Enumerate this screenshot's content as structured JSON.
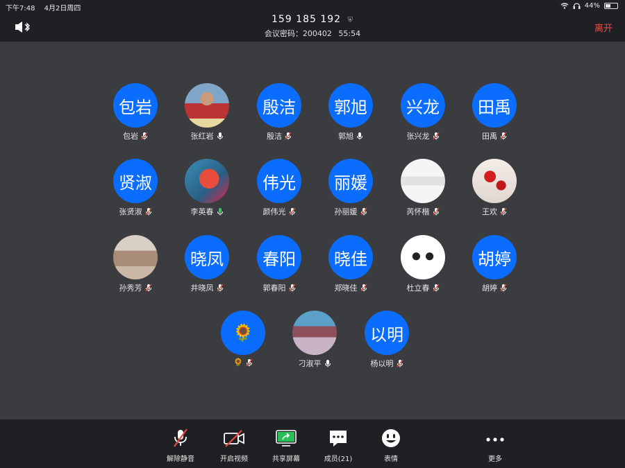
{
  "status": {
    "time": "下午7:48",
    "date": "4月2日周四",
    "battery": "44%",
    "battery_level": 0.44
  },
  "header": {
    "meeting_id": "159 185 192",
    "sub_label": "会议密码：200402",
    "elapsed": "55:54",
    "leave_label": "离开"
  },
  "participants": [
    {
      "avatar_text": "包岩",
      "name": "包岩",
      "mic": "muted"
    },
    {
      "avatar_text": "",
      "name": "张红岩",
      "mic": "on"
    },
    {
      "avatar_text": "殷洁",
      "name": "殷洁",
      "mic": "muted"
    },
    {
      "avatar_text": "郭旭",
      "name": "郭旭",
      "mic": "on"
    },
    {
      "avatar_text": "兴龙",
      "name": "张兴龙",
      "mic": "muted"
    },
    {
      "avatar_text": "田禹",
      "name": "田禹",
      "mic": "muted"
    },
    {
      "avatar_text": "贤淑",
      "name": "张贤淑",
      "mic": "muted"
    },
    {
      "avatar_text": "",
      "name": "李英春",
      "mic": "active"
    },
    {
      "avatar_text": "伟光",
      "name": "颜伟光",
      "mic": "muted"
    },
    {
      "avatar_text": "丽媛",
      "name": "孙丽媛",
      "mic": "muted"
    },
    {
      "avatar_text": "",
      "name": "芮怀楷",
      "mic": "muted"
    },
    {
      "avatar_text": "",
      "name": "王欢",
      "mic": "muted"
    },
    {
      "avatar_text": "",
      "name": "孙秀芳",
      "mic": "muted"
    },
    {
      "avatar_text": "晓凤",
      "name": "井晓凤",
      "mic": "muted"
    },
    {
      "avatar_text": "春阳",
      "name": "郭春阳",
      "mic": "muted"
    },
    {
      "avatar_text": "晓佳",
      "name": "郑晓佳",
      "mic": "muted"
    },
    {
      "avatar_text": "",
      "name": "杜立春",
      "mic": "muted"
    },
    {
      "avatar_text": "胡婷",
      "name": "胡婷",
      "mic": "muted"
    },
    {
      "avatar_text": "🌻",
      "name": "🌻",
      "mic": "muted"
    },
    {
      "avatar_text": "",
      "name": "刁淑平",
      "mic": "on"
    },
    {
      "avatar_text": "以明",
      "name": "杨以明",
      "mic": "muted"
    }
  ],
  "toolbar": {
    "unmute": "解除静音",
    "start_video": "开启视频",
    "share_screen": "共享屏幕",
    "members": "成员(21)",
    "reactions": "表情",
    "more": "更多"
  },
  "colors": {
    "accent": "#0a6dff",
    "leave": "#f24a45",
    "share_green": "#2bbf5b",
    "mic_muted_red": "#e84a3f",
    "mic_active_green": "#43c463"
  }
}
